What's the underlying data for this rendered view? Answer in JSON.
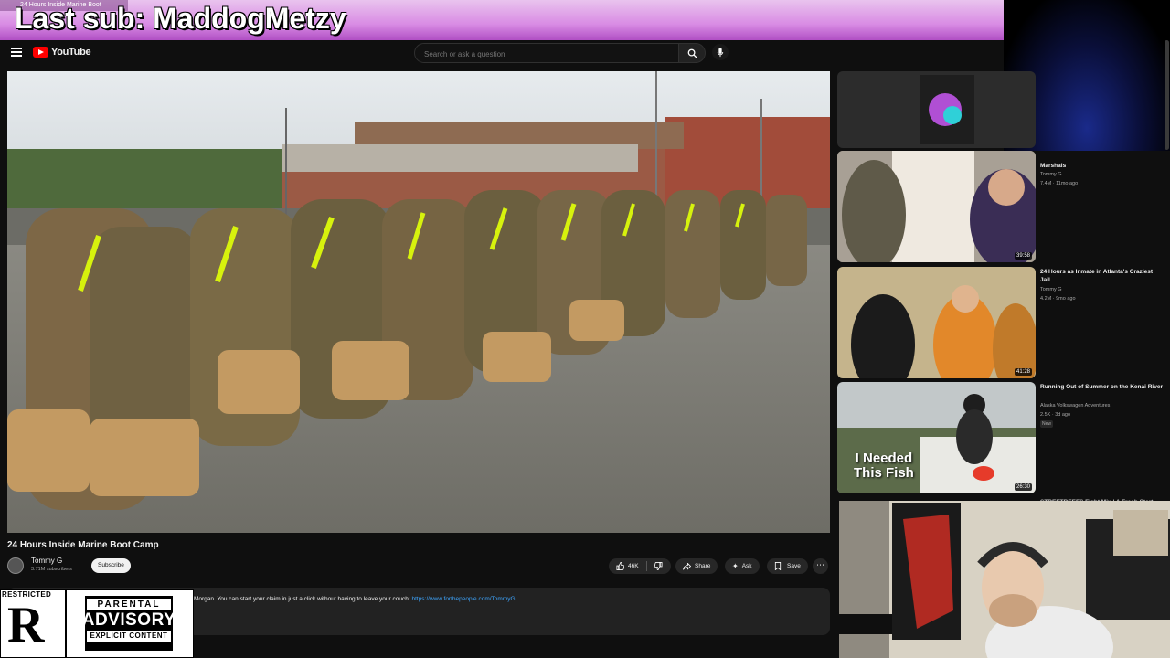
{
  "stream_overlay": {
    "banner_text": "Last sub: MaddogMetzy",
    "browser_tab_hint": "24 Hours Inside Marine Boot"
  },
  "header": {
    "logo_text": "YouTube",
    "search_placeholder": "Search or ask a question"
  },
  "video": {
    "title": "24 Hours Inside Marine Boot Camp",
    "channel": "Tommy G",
    "subscribers": "3.71M subscribers",
    "subscribe_label": "Subscribe",
    "likes": "46K",
    "share_label": "Share",
    "ask_label": "Ask",
    "save_label": "Save",
    "more_label": "⋯"
  },
  "description": {
    "text": "Morgan. You can start your claim in just a click without having to leave your couch:",
    "link": "https://www.forthepeople.com/TommyG"
  },
  "advisory": {
    "restricted_label": "RESTRICTED",
    "restricted_letter": "R",
    "top": "PARENTAL",
    "middle": "ADVISORY",
    "bottom": "EXPLICIT CONTENT"
  },
  "recommendations": [
    {
      "title": "Marshals",
      "channel": "Tommy G",
      "meta": "7.4M · 11mo ago",
      "duration": "39:58"
    },
    {
      "title": "24 Hours as Inmate in Atlanta's Craziest Jail",
      "channel": "Tommy G",
      "meta": "4.2M · 9mo ago",
      "duration": "41:28"
    },
    {
      "title": "Running Out of Summer on the Kenai River",
      "channel": "Alaska Volkswagen Adventures",
      "meta": "2.5K · 3d ago",
      "badge": "New",
      "duration": "26:30",
      "thumb_text_1": "I Needed",
      "thumb_text_2": "This Fish"
    },
    {
      "title": "STREETBEEFS Fight Mix | A Fresh Start"
    }
  ],
  "colors": {
    "banner": "#d98ce4",
    "youtube_red": "#ff0000",
    "link": "#3ea6ff",
    "background": "#0f0f0f"
  }
}
